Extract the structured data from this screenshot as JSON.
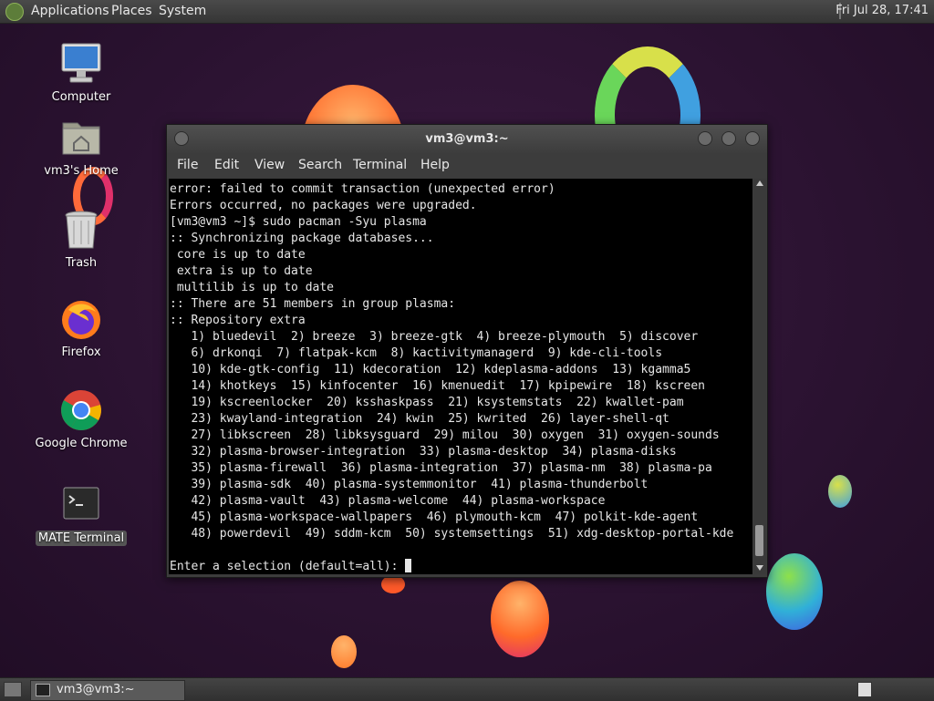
{
  "top_panel": {
    "menus": [
      "Applications",
      "Places",
      "System"
    ],
    "clock": "Fri Jul 28, 17:41"
  },
  "desktop_icons": [
    {
      "label": "Computer",
      "icon": "computer-icon"
    },
    {
      "label": "vm3's Home",
      "icon": "home-folder-icon"
    },
    {
      "label": "Trash",
      "icon": "trash-icon"
    },
    {
      "label": "Firefox",
      "icon": "firefox-icon"
    },
    {
      "label": "Google Chrome",
      "icon": "chrome-icon"
    },
    {
      "label": "MATE Terminal",
      "icon": "terminal-icon"
    }
  ],
  "terminal": {
    "title": "vm3@vm3:~",
    "menu": [
      "File",
      "Edit",
      "View",
      "Search",
      "Terminal",
      "Help"
    ],
    "lines": [
      "error: failed to commit transaction (unexpected error)",
      "Errors occurred, no packages were upgraded.",
      "[vm3@vm3 ~]$ sudo pacman -Syu plasma",
      ":: Synchronizing package databases...",
      " core is up to date",
      " extra is up to date",
      " multilib is up to date",
      ":: There are 51 members in group plasma:",
      ":: Repository extra",
      "   1) bluedevil  2) breeze  3) breeze-gtk  4) breeze-plymouth  5) discover",
      "   6) drkonqi  7) flatpak-kcm  8) kactivitymanagerd  9) kde-cli-tools",
      "   10) kde-gtk-config  11) kdecoration  12) kdeplasma-addons  13) kgamma5",
      "   14) khotkeys  15) kinfocenter  16) kmenuedit  17) kpipewire  18) kscreen",
      "   19) kscreenlocker  20) ksshaskpass  21) ksystemstats  22) kwallet-pam",
      "   23) kwayland-integration  24) kwin  25) kwrited  26) layer-shell-qt",
      "   27) libkscreen  28) libksysguard  29) milou  30) oxygen  31) oxygen-sounds",
      "   32) plasma-browser-integration  33) plasma-desktop  34) plasma-disks",
      "   35) plasma-firewall  36) plasma-integration  37) plasma-nm  38) plasma-pa",
      "   39) plasma-sdk  40) plasma-systemmonitor  41) plasma-thunderbolt",
      "   42) plasma-vault  43) plasma-welcome  44) plasma-workspace",
      "   45) plasma-workspace-wallpapers  46) plymouth-kcm  47) polkit-kde-agent",
      "   48) powerdevil  49) sddm-kcm  50) systemsettings  51) xdg-desktop-portal-kde",
      "",
      "Enter a selection (default=all): "
    ]
  },
  "taskbar": {
    "window_label": "vm3@vm3:~"
  }
}
